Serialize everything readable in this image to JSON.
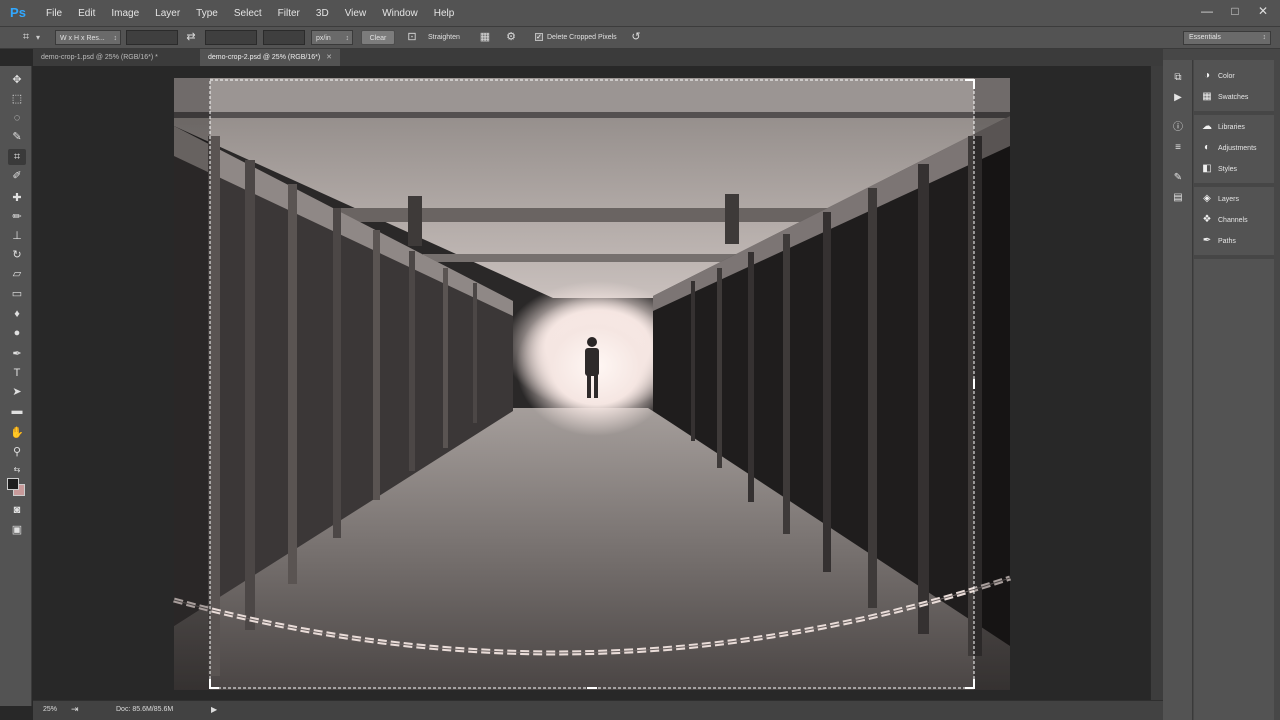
{
  "app": {
    "logo": "Ps"
  },
  "menu": [
    "File",
    "Edit",
    "Image",
    "Layer",
    "Type",
    "Select",
    "Filter",
    "3D",
    "View",
    "Window",
    "Help"
  ],
  "window_controls": {
    "minimize": "—",
    "maximize": "□",
    "close": "✕"
  },
  "options": {
    "ratio_select": "W x H x Res...",
    "width_value": "",
    "height_value": "",
    "resolution_value": "",
    "unit_select": "px/in",
    "clear_label": "Clear",
    "straighten_label": "Straighten",
    "delete_cropped_label": "Delete Cropped Pixels",
    "delete_cropped_checked": true,
    "workspace": "Essentials"
  },
  "tabs": [
    {
      "label": "demo-crop-1.psd @ 25% (RGB/16*) *",
      "active": false
    },
    {
      "label": "demo-crop-2.psd @ 25% (RGB/16*)",
      "active": true
    }
  ],
  "tools": [
    "move-tool",
    "marquee-tool",
    "lasso-tool",
    "quick-selection-tool",
    "crop-tool",
    "eyedropper-tool",
    "healing-brush-tool",
    "brush-tool",
    "clone-stamp-tool",
    "history-brush-tool",
    "eraser-tool",
    "gradient-tool",
    "blur-tool",
    "dodge-tool",
    "pen-tool",
    "type-tool",
    "path-selection-tool",
    "rectangle-tool",
    "hand-tool",
    "zoom-tool"
  ],
  "status": {
    "zoom": "25%",
    "doc": "Doc: 85.6M/85.6M"
  },
  "panels": {
    "group1": [
      {
        "label": "Color",
        "icon": "color-icon"
      },
      {
        "label": "Swatches",
        "icon": "swatches-icon"
      }
    ],
    "group2": [
      {
        "label": "Libraries",
        "icon": "libraries-icon"
      },
      {
        "label": "Adjustments",
        "icon": "adjustments-icon"
      },
      {
        "label": "Styles",
        "icon": "styles-icon"
      }
    ],
    "group3": [
      {
        "label": "Layers",
        "icon": "layers-icon"
      },
      {
        "label": "Channels",
        "icon": "channels-icon"
      },
      {
        "label": "Paths",
        "icon": "paths-icon"
      }
    ]
  },
  "colors": {
    "foreground": "#1e1e1e",
    "background": "#c89a9a",
    "ps_blue": "#31a8ff"
  }
}
